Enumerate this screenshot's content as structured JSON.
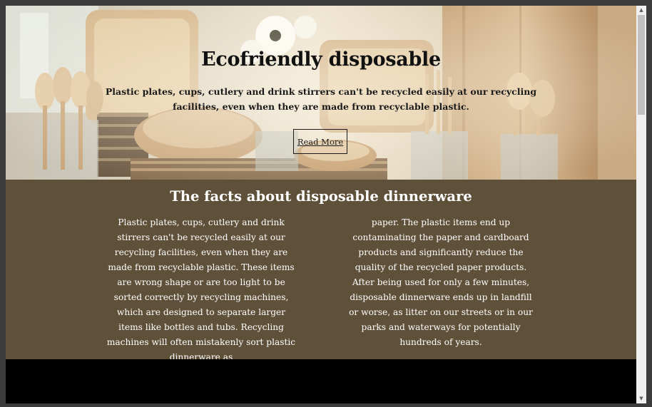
{
  "hero": {
    "title": "Ecofriendly disposable",
    "text": "Plastic plates, cups, cutlery and drink stirrers can't be recycled easily at our recycling facilities, even when they are made from recyclable plastic.",
    "button_label": "Read More"
  },
  "facts": {
    "title": "The facts about disposable dinnerware",
    "col_left": "Plastic plates, cups, cutlery and drink stirrers can't be recycled easily at our recycling facilities, even when they are made from recyclable plastic. These items are wrong shape or are too light to be sorted correctly by recycling machines, which are designed to separate larger items like bottles and tubs. Recycling machines will often mistakenly sort plastic dinnerware as",
    "col_right": "paper. The plastic items end up contaminating the paper and cardboard products and significantly reduce the quality of the recycled paper products. After being used for only a few minutes, disposable dinnerware ends up in landfill or worse, as litter on our streets or in our parks and waterways for potentially hundreds of years."
  },
  "colors": {
    "facts_background": "#5f5039",
    "facts_text": "#ffffff",
    "hero_text": "#1a1a1a",
    "page_bottom": "#000000"
  },
  "icons": {
    "scroll_up": "scroll-up-arrow-icon",
    "scroll_down": "scroll-down-arrow-icon"
  },
  "scrollbar": {
    "up_glyph": "▲",
    "down_glyph": "▼"
  }
}
